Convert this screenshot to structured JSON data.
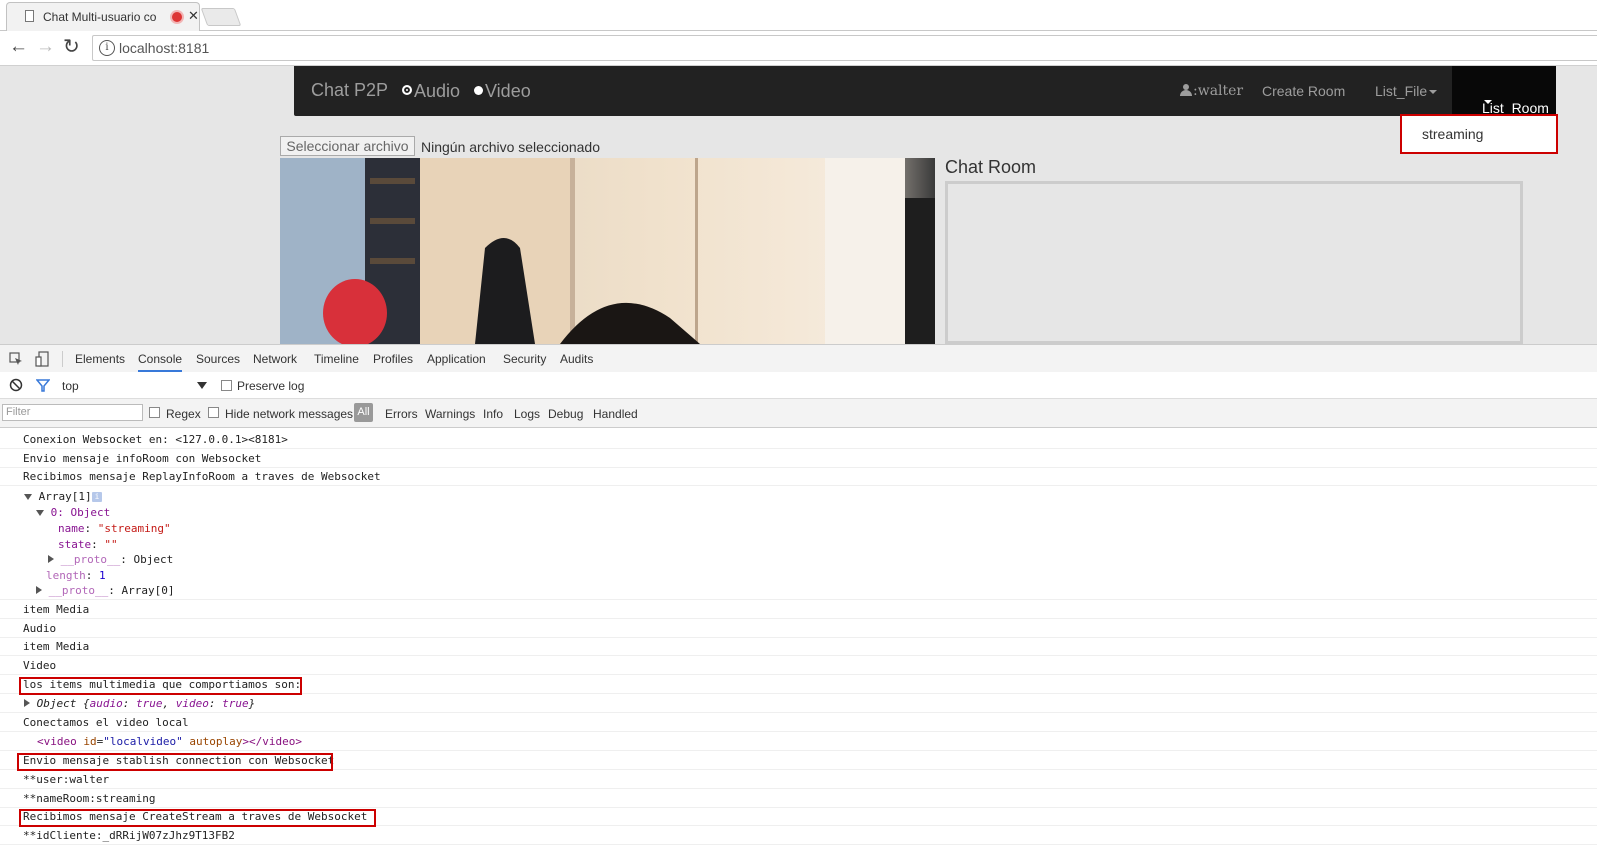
{
  "browser": {
    "tab_title": "Chat Multi-usuario co",
    "tab_close": "✕",
    "url": "localhost:8181",
    "info_icon": "i",
    "back": "←",
    "forward": "→",
    "reload": "↻"
  },
  "navbar": {
    "brand": "Chat P2P",
    "audio_label": "Audio",
    "video_label": "Video",
    "user": ":walter",
    "create_room": "Create Room",
    "list_file": "List_File",
    "list_room": "List_Room",
    "dropdown_item": "streaming"
  },
  "page": {
    "file_button": "Seleccionar archivo",
    "file_status": "Ningún archivo seleccionado",
    "chat_title": "Chat Room"
  },
  "devtools": {
    "tabs": [
      "Elements",
      "Console",
      "Sources",
      "Network",
      "Timeline",
      "Profiles",
      "Application",
      "Security",
      "Audits"
    ],
    "active_tab": "Console",
    "context": "top",
    "preserve_log": "Preserve log",
    "filter_placeholder": "Filter",
    "regex": "Regex",
    "hide_network": "Hide network messages",
    "levels": [
      "All",
      "Errors",
      "Warnings",
      "Info",
      "Logs",
      "Debug",
      "Handled"
    ],
    "active_level": "All"
  },
  "console": {
    "l1": "Conexion Websocket en: <127.0.0.1><8181>",
    "l2": "Envio mensaje infoRoom con Websocket",
    "l3": "Recibimos mensaje ReplayInfoRoom a traves de Websocket",
    "array_label": "Array[1]",
    "obj0": "0: Object",
    "name_key": "name",
    "name_val": "\"streaming\"",
    "state_key": "state",
    "state_val": "\"\"",
    "proto_key": "__proto__",
    "proto_obj": "Object",
    "length_key": "length",
    "length_val": "1",
    "proto_arr": "Array[0]",
    "l4": "item Media",
    "l5": "Audio",
    "l6": "item Media",
    "l7": "Video",
    "l8": "los items multimedia que comportiamos son:",
    "obj_summary_prefix": "Object {",
    "obj_audio_key": "audio",
    "obj_audio_val": "true",
    "obj_video_key": "video",
    "obj_video_val": "true",
    "obj_summary_suffix": "}",
    "l9": "Conectamos el video local",
    "video_tag_open": "<video",
    "video_attr1": "id",
    "video_attr1_val": "\"localvideo\"",
    "video_attr2": "autoplay",
    "video_tag_close": "></video>",
    "l10": "Envio mensaje stablish connection con Websocket",
    "l11": "**user:walter",
    "l12": "**nameRoom:streaming",
    "l13": "Recibimos mensaje CreateStream a traves de Websocket",
    "l14": "**idCliente:_dRRijW07zJhz9T13FB2"
  },
  "colors": {
    "highlight": "#cc0000",
    "navbar_bg": "#222222",
    "active_tab_underline": "#3879d9"
  }
}
